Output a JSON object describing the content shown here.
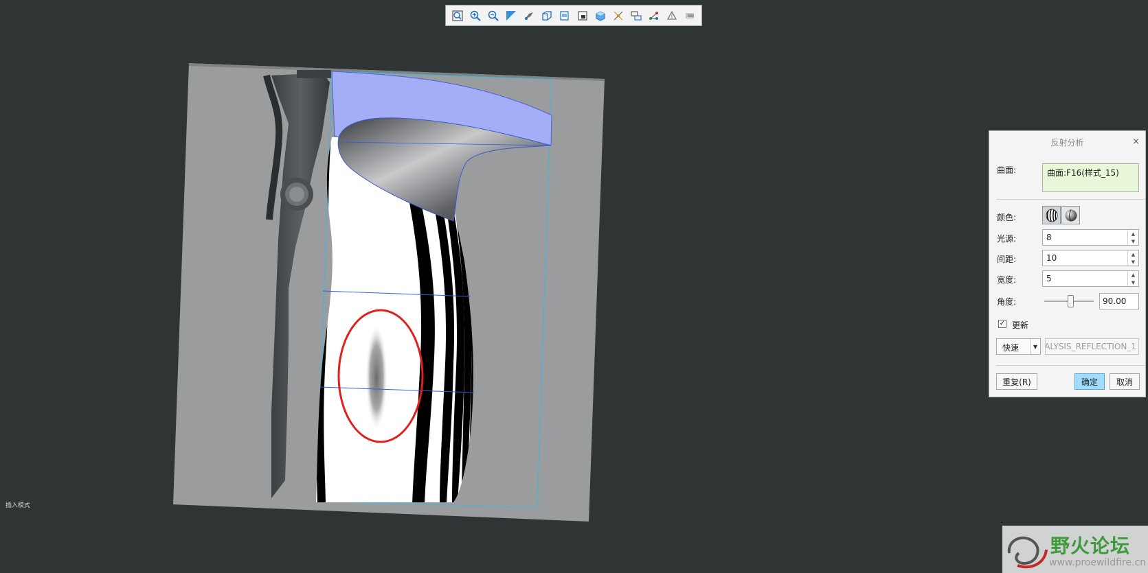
{
  "toolbar": {
    "icons": [
      "zoom-fit-icon",
      "zoom-in-icon",
      "zoom-out-icon",
      "repaint-icon",
      "spin-center-icon",
      "view-orientation-icon",
      "saved-views-icon",
      "view-manager-icon",
      "display-style-icon",
      "datum-display-icon",
      "annotation-display-icon",
      "point-display-icon",
      "coordinate-system-icon",
      "next-icon"
    ]
  },
  "viewport": {
    "mode_label": "插入模式"
  },
  "dialog": {
    "title": "反射分析",
    "close_glyph": "×",
    "surface_label": "曲面:",
    "surface_value": "曲面:F16(样式_15)",
    "color_label": "颜色:",
    "light_label": "光源:",
    "light_value": "8",
    "spacing_label": "间距:",
    "spacing_value": "10",
    "width_label": "宽度:",
    "width_value": "5",
    "angle_label": "角度:",
    "angle_value": "90.00",
    "update_label": "更新",
    "update_checked": true,
    "mode_value": "快速",
    "analysis_name": "ALYSIS_REFLECTION_1",
    "repeat_label": "重复(R)",
    "ok_label": "确定",
    "cancel_label": "取消"
  },
  "watermark": {
    "text": "野火论坛",
    "url": "www.proewildfire.cn"
  },
  "colors": {
    "background": "#2f3435",
    "highlight_surface": "#a3aef7",
    "annotation_circle": "#e0201c",
    "primary_button": "#9fdcff"
  }
}
